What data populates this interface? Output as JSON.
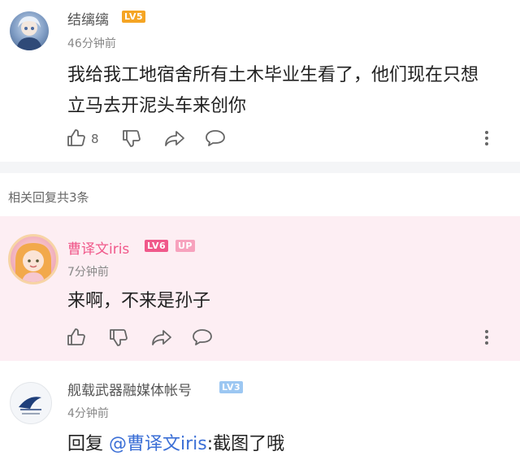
{
  "comment": {
    "username": "结缡缡",
    "level": "LV5",
    "time": "46分钟前",
    "text_line1": "我给我工地宿舍所有土木毕业生看了，他们现在只想",
    "text_line2": "立马去开泥头车来创你",
    "like_count": "8"
  },
  "replies_header": "相关回复共3条",
  "reply1": {
    "username": "曹译文iris",
    "level": "LV6",
    "badge": "UP",
    "time": "7分钟前",
    "text": "来啊，不来是孙子"
  },
  "reply2": {
    "username": "舰载武器融媒体帐号",
    "level": "LV3",
    "time": "4分钟前",
    "reply_prefix": "回复",
    "mention": "@曹译文iris",
    "text": ":截图了哦"
  },
  "colors": {
    "highlight_bg": "#fdeef3",
    "pink_name": "#f0588a",
    "mention": "#3b6fd6",
    "lv_orange": "#f5a524"
  }
}
